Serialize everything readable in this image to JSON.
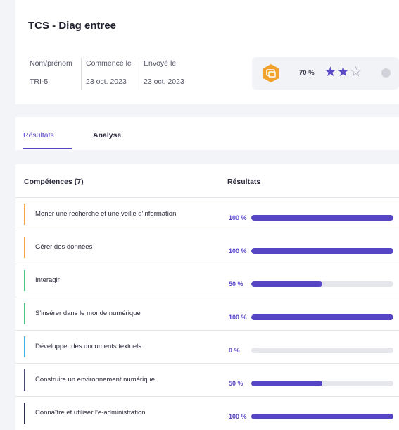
{
  "header": {
    "title": "TCS - Diag entree",
    "meta": [
      {
        "label": "Nom/prénom",
        "value": "TRI-5"
      },
      {
        "label": "Commencé le",
        "value": "23 oct. 2023"
      },
      {
        "label": "Envoyé le",
        "value": "23 oct. 2023"
      }
    ],
    "score": {
      "percent_text": "70 %",
      "stars_filled": 2,
      "stars_total": 3,
      "badge_icon": "certificate-badge-icon",
      "badge_color": "#f0a22a"
    }
  },
  "tabs": [
    {
      "label": "Résultats",
      "active": true
    },
    {
      "label": "Analyse",
      "active": false
    }
  ],
  "table": {
    "col_competences": "Compétences (7)",
    "col_resultats": "Résultats",
    "rows": [
      {
        "label": "Mener une recherche et une veille d'information",
        "pct_text": "100 %",
        "value": 100,
        "accent": "#f0a64a"
      },
      {
        "label": "Gérer des données",
        "pct_text": "100 %",
        "value": 100,
        "accent": "#f0a64a"
      },
      {
        "label": "Interagir",
        "pct_text": "50 %",
        "value": 50,
        "accent": "#4cc58a"
      },
      {
        "label": "S'insérer dans le monde numérique",
        "pct_text": "100 %",
        "value": 100,
        "accent": "#4cc58a"
      },
      {
        "label": "Développer des documents textuels",
        "pct_text": "0 %",
        "value": 0,
        "accent": "#3fb3e8"
      },
      {
        "label": "Construire un environnement numérique",
        "pct_text": "50 %",
        "value": 50,
        "accent": "#4a4a7a"
      },
      {
        "label": "Connaître et utiliser l'e-administration",
        "pct_text": "100 %",
        "value": 100,
        "accent": "#2a2a4a"
      }
    ]
  },
  "colors": {
    "accent": "#5646c6",
    "track": "#e6e7ec"
  }
}
